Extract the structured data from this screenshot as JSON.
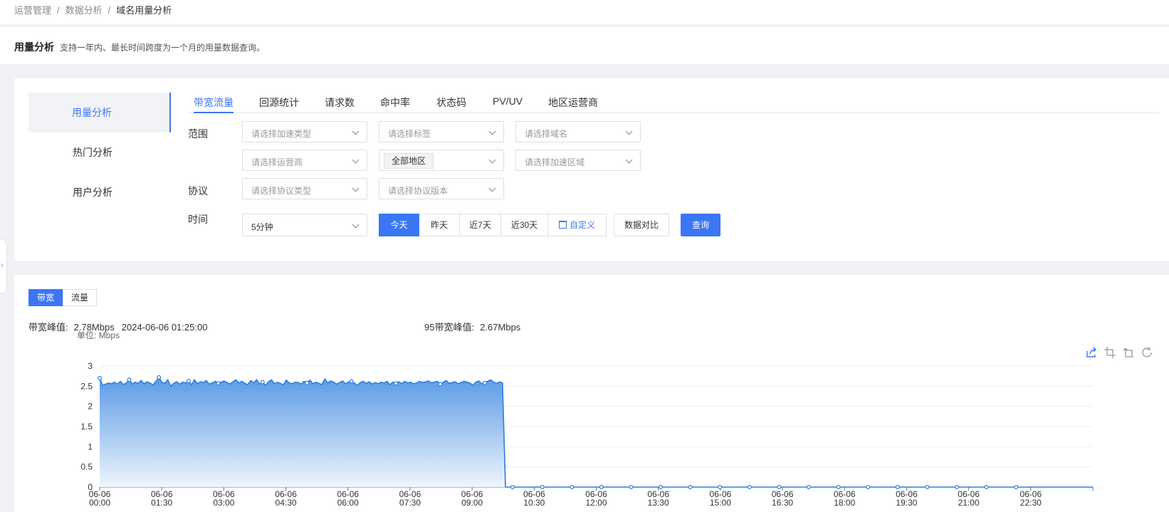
{
  "breadcrumb": {
    "items": [
      "运营管理",
      "数据分析",
      "域名用量分析"
    ]
  },
  "header": {
    "title": "用量分析",
    "desc": "支持一年内、最长时间跨度为一个月的用量数据查询。"
  },
  "left_nav": {
    "items": [
      "用量分析",
      "热门分析",
      "用户分析"
    ]
  },
  "tabs": [
    "带宽流量",
    "回源统计",
    "请求数",
    "命中率",
    "状态码",
    "PV/UV",
    "地区运营商"
  ],
  "filters": {
    "scope_label": "范围",
    "protocol_label": "协议",
    "time_label": "时间",
    "accel_type_placeholder": "请选择加速类型",
    "tag_placeholder": "请选择标签",
    "domain_placeholder": "请选择域名",
    "isp_placeholder": "请选择运营商",
    "region_selected": "全部地区",
    "accel_region_placeholder": "请选择加速区域",
    "protocol_type_placeholder": "请选择协议类型",
    "protocol_version_placeholder": "请选择协议版本",
    "granularity_value": "5分钟",
    "time_buttons": [
      "今天",
      "昨天",
      "近7天",
      "近30天"
    ],
    "custom_label": "自定义",
    "compare_label": "数据对比",
    "query_label": "查询"
  },
  "metric_toggle": [
    "带宽",
    "流量"
  ],
  "stats": {
    "peak_label": "带宽峰值:",
    "peak_value": "2.78Mbps",
    "peak_time": "2024-06-06 01:25:00",
    "p95_label": "95带宽峰值:",
    "p95_value": "2.67Mbps"
  },
  "colors": {
    "accent": "#3b77f4",
    "line": "#2f7de1",
    "fill_top": "#5b9be6",
    "fill_bottom": "#eef5fd"
  },
  "chart_icons": [
    "share-icon",
    "zoom-select-icon",
    "zoom-reset-icon",
    "refresh-icon"
  ],
  "chart_data": {
    "type": "area",
    "unit_label": "单位: Mbps",
    "ylim": [
      0,
      3
    ],
    "yticks": [
      "0",
      "0.5",
      "1",
      "1.5",
      "2",
      "2.5",
      "3"
    ],
    "xticks": [
      [
        "06-06",
        "00:00"
      ],
      [
        "06-06",
        "01:30"
      ],
      [
        "06-06",
        "03:00"
      ],
      [
        "06-06",
        "04:30"
      ],
      [
        "06-06",
        "06:00"
      ],
      [
        "06-06",
        "07:30"
      ],
      [
        "06-06",
        "09:00"
      ],
      [
        "06-06",
        "10:30"
      ],
      [
        "06-06",
        "12:00"
      ],
      [
        "06-06",
        "13:30"
      ],
      [
        "06-06",
        "15:00"
      ],
      [
        "06-06",
        "16:30"
      ],
      [
        "06-06",
        "18:00"
      ],
      [
        "06-06",
        "19:30"
      ],
      [
        "06-06",
        "21:00"
      ],
      [
        "06-06",
        "22:30"
      ]
    ],
    "series": [
      {
        "values": [
          2.7,
          2.52,
          2.55,
          2.58,
          2.56,
          2.6,
          2.55,
          2.62,
          2.54,
          2.58,
          2.66,
          2.55,
          2.6,
          2.57,
          2.64,
          2.56,
          2.61,
          2.58,
          2.53,
          2.62,
          2.72,
          2.6,
          2.57,
          2.66,
          2.5,
          2.57,
          2.61,
          2.55,
          2.6,
          2.58,
          2.63,
          2.53,
          2.66,
          2.56,
          2.61,
          2.59,
          2.64,
          2.55,
          2.58,
          2.62,
          2.57,
          2.6,
          2.63,
          2.59,
          2.55,
          2.61,
          2.66,
          2.58,
          2.62,
          2.57,
          2.54,
          2.64,
          2.58,
          2.66,
          2.55,
          2.6,
          2.52,
          2.61,
          2.66,
          2.56,
          2.6,
          2.57,
          2.53,
          2.65,
          2.58,
          2.56,
          2.6,
          2.59,
          2.55,
          2.62,
          2.58,
          2.65,
          2.56,
          2.6,
          2.57,
          2.54,
          2.68,
          2.58,
          2.63,
          2.6,
          2.55,
          2.59,
          2.63,
          2.56,
          2.6,
          2.62,
          2.58,
          2.52,
          2.59,
          2.62,
          2.57,
          2.61,
          2.55,
          2.59,
          2.56,
          2.6,
          2.58,
          2.62,
          2.54,
          2.6,
          2.57,
          2.61,
          2.56,
          2.62,
          2.58,
          2.6,
          2.56,
          2.58,
          2.62,
          2.59,
          2.61,
          2.63,
          2.58,
          2.6,
          2.62,
          2.55,
          2.6,
          2.64,
          2.57,
          2.59,
          2.61,
          2.56,
          2.59,
          2.62,
          2.6,
          2.58,
          2.52,
          2.6,
          2.63,
          2.56,
          2.58,
          2.62,
          2.66,
          2.6,
          2.57,
          2.61,
          2.58,
          0
        ]
      }
    ]
  }
}
